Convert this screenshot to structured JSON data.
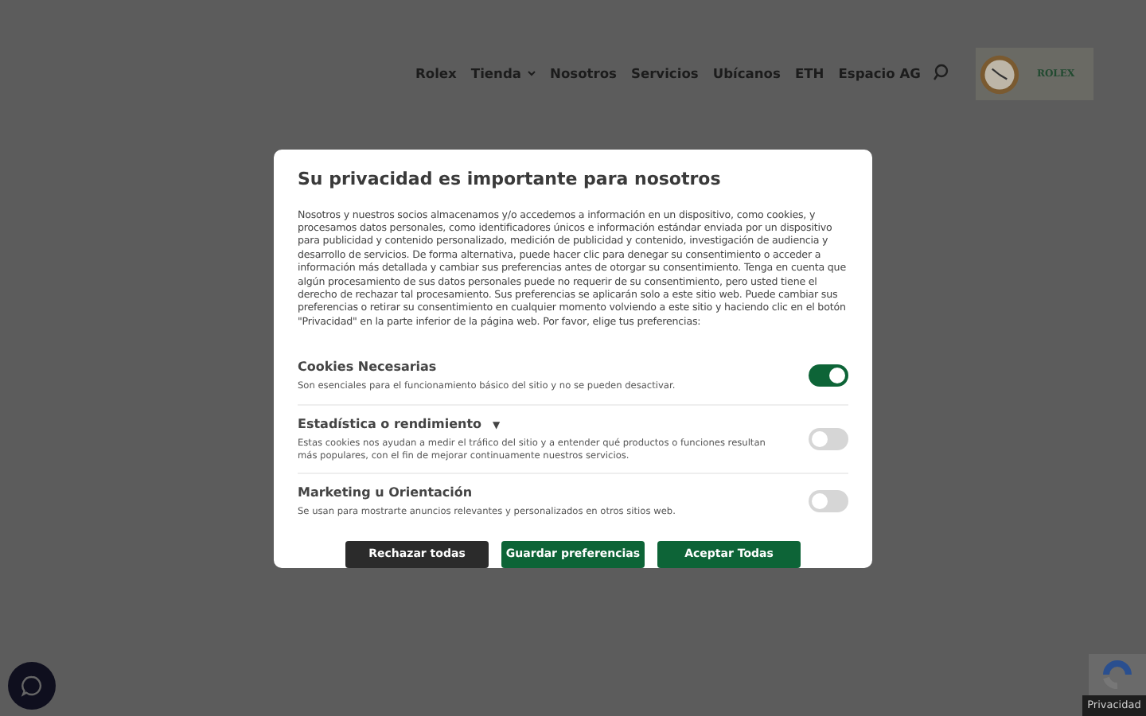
{
  "nav": {
    "items": [
      {
        "label": "Rolex",
        "dropdown": false
      },
      {
        "label": "Tienda",
        "dropdown": true
      },
      {
        "label": "Nosotros",
        "dropdown": false
      },
      {
        "label": "Servicios",
        "dropdown": false
      },
      {
        "label": "Ubícanos",
        "dropdown": false
      },
      {
        "label": "ETH",
        "dropdown": false
      },
      {
        "label": "Espacio AG",
        "dropdown": false
      }
    ],
    "logo_text": "ROLEX"
  },
  "dialog": {
    "title": "Su privacidad es importante para nosotros",
    "body": "Nosotros y nuestros socios almacenamos y/o accedemos a información en un dispositivo, como cookies, y procesamos datos personales, como identificadores únicos e información estándar enviada por un dispositivo para publicidad y contenido personalizado, medición de publicidad y contenido, investigación de audiencia y desarrollo de servicios. De forma alternativa, puede hacer clic para denegar su consentimiento o acceder a información más detallada y cambiar sus preferencias antes de otorgar su consentimiento. Tenga en cuenta que algún procesamiento de sus datos personales puede no requerir de su consentimiento, pero usted tiene el derecho de rechazar tal procesamiento. Sus preferencias se aplicarán solo a este sitio web. Puede cambiar sus preferencias o retirar su consentimiento en cualquier momento volviendo a este sitio y haciendo clic en el botón \"Privacidad\" en la parte inferior de la página web. Por favor, elige tus preferencias:",
    "categories": [
      {
        "title": "Cookies Necesarias",
        "description": "Son esenciales para el funcionamiento básico del sitio y no se pueden desactivar.",
        "on": true
      },
      {
        "title": "Estadística o rendimiento",
        "caret": "▼",
        "description": "Estas cookies nos ayudan a medir el tráfico del sitio y a entender qué productos o funciones resultan más populares, con el fin de mejorar continuamente nuestros servicios.",
        "on": false
      },
      {
        "title": "Marketing u Orientación",
        "description": "Se usan para mostrarte anuncios relevantes y personalizados en otros sitios web.",
        "on": false
      }
    ],
    "buttons": [
      {
        "label": "Rechazar todas",
        "kind": "secondary"
      },
      {
        "label": "Guardar preferencias",
        "kind": "primary"
      },
      {
        "label": "Aceptar Todas",
        "kind": "primary"
      }
    ]
  },
  "privacy_tab": "Privacidad"
}
